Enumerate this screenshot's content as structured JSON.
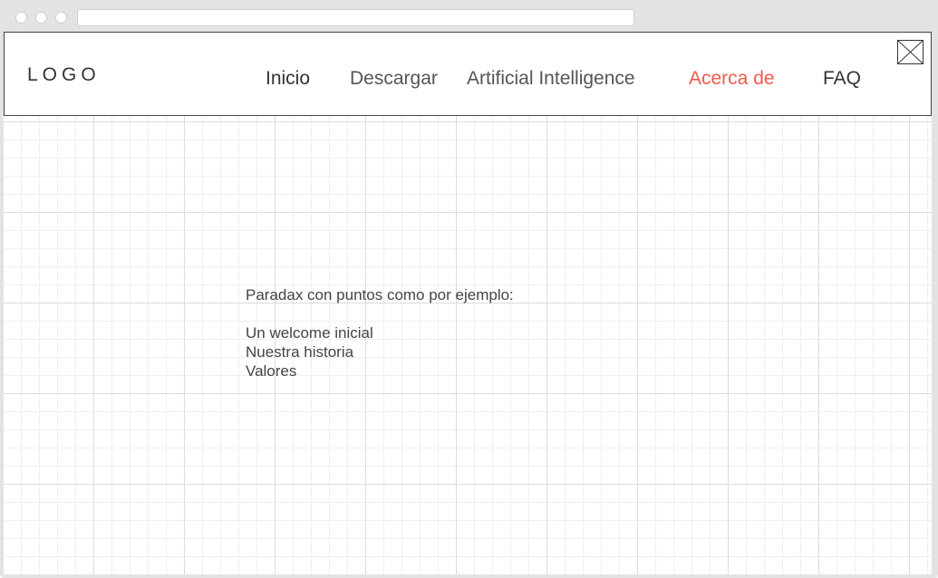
{
  "header": {
    "logo": "LOGO",
    "nav": [
      {
        "label": "Inicio",
        "state": "default"
      },
      {
        "label": "Descargar",
        "state": "default"
      },
      {
        "label": "Artificial Intelligence",
        "state": "default"
      },
      {
        "label": "Acerca de",
        "state": "active"
      },
      {
        "label": "FAQ",
        "state": "default"
      }
    ],
    "image_placeholder_icon": "image-placeholder-icon"
  },
  "content": {
    "intro": "Paradax con puntos como por ejemplo:",
    "items": [
      "Un welcome inicial",
      "Nuestra historia",
      "Valores"
    ]
  },
  "colors": {
    "accent": "#f05a4f",
    "text": "#333333",
    "grid": "#dcdcdc"
  }
}
